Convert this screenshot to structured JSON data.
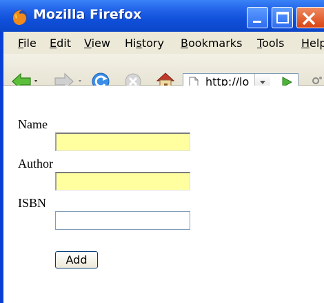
{
  "window": {
    "title": "Mozilla Firefox"
  },
  "menu": {
    "items": [
      {
        "label": "File",
        "accel": "F"
      },
      {
        "label": "Edit",
        "accel": "E"
      },
      {
        "label": "View",
        "accel": "V"
      },
      {
        "label": "History",
        "accel": "s"
      },
      {
        "label": "Bookmarks",
        "accel": "B"
      },
      {
        "label": "Tools",
        "accel": "T"
      },
      {
        "label": "Help",
        "accel": "H"
      }
    ]
  },
  "navbar": {
    "back_icon": "back-arrow-icon",
    "forward_icon": "forward-arrow-icon",
    "reload_icon": "reload-icon",
    "stop_icon": "stop-icon",
    "home_icon": "home-icon",
    "url": "http://lo",
    "go_icon": "go-arrow-icon"
  },
  "form": {
    "name_label": "Name",
    "name_value": "",
    "author_label": "Author",
    "author_value": "",
    "isbn_label": "ISBN",
    "isbn_value": "",
    "add_label": "Add"
  },
  "colors": {
    "titlebar": "#0f4fd9",
    "menubar": "#ece9d8",
    "highlight_field": "#ffffa0"
  }
}
